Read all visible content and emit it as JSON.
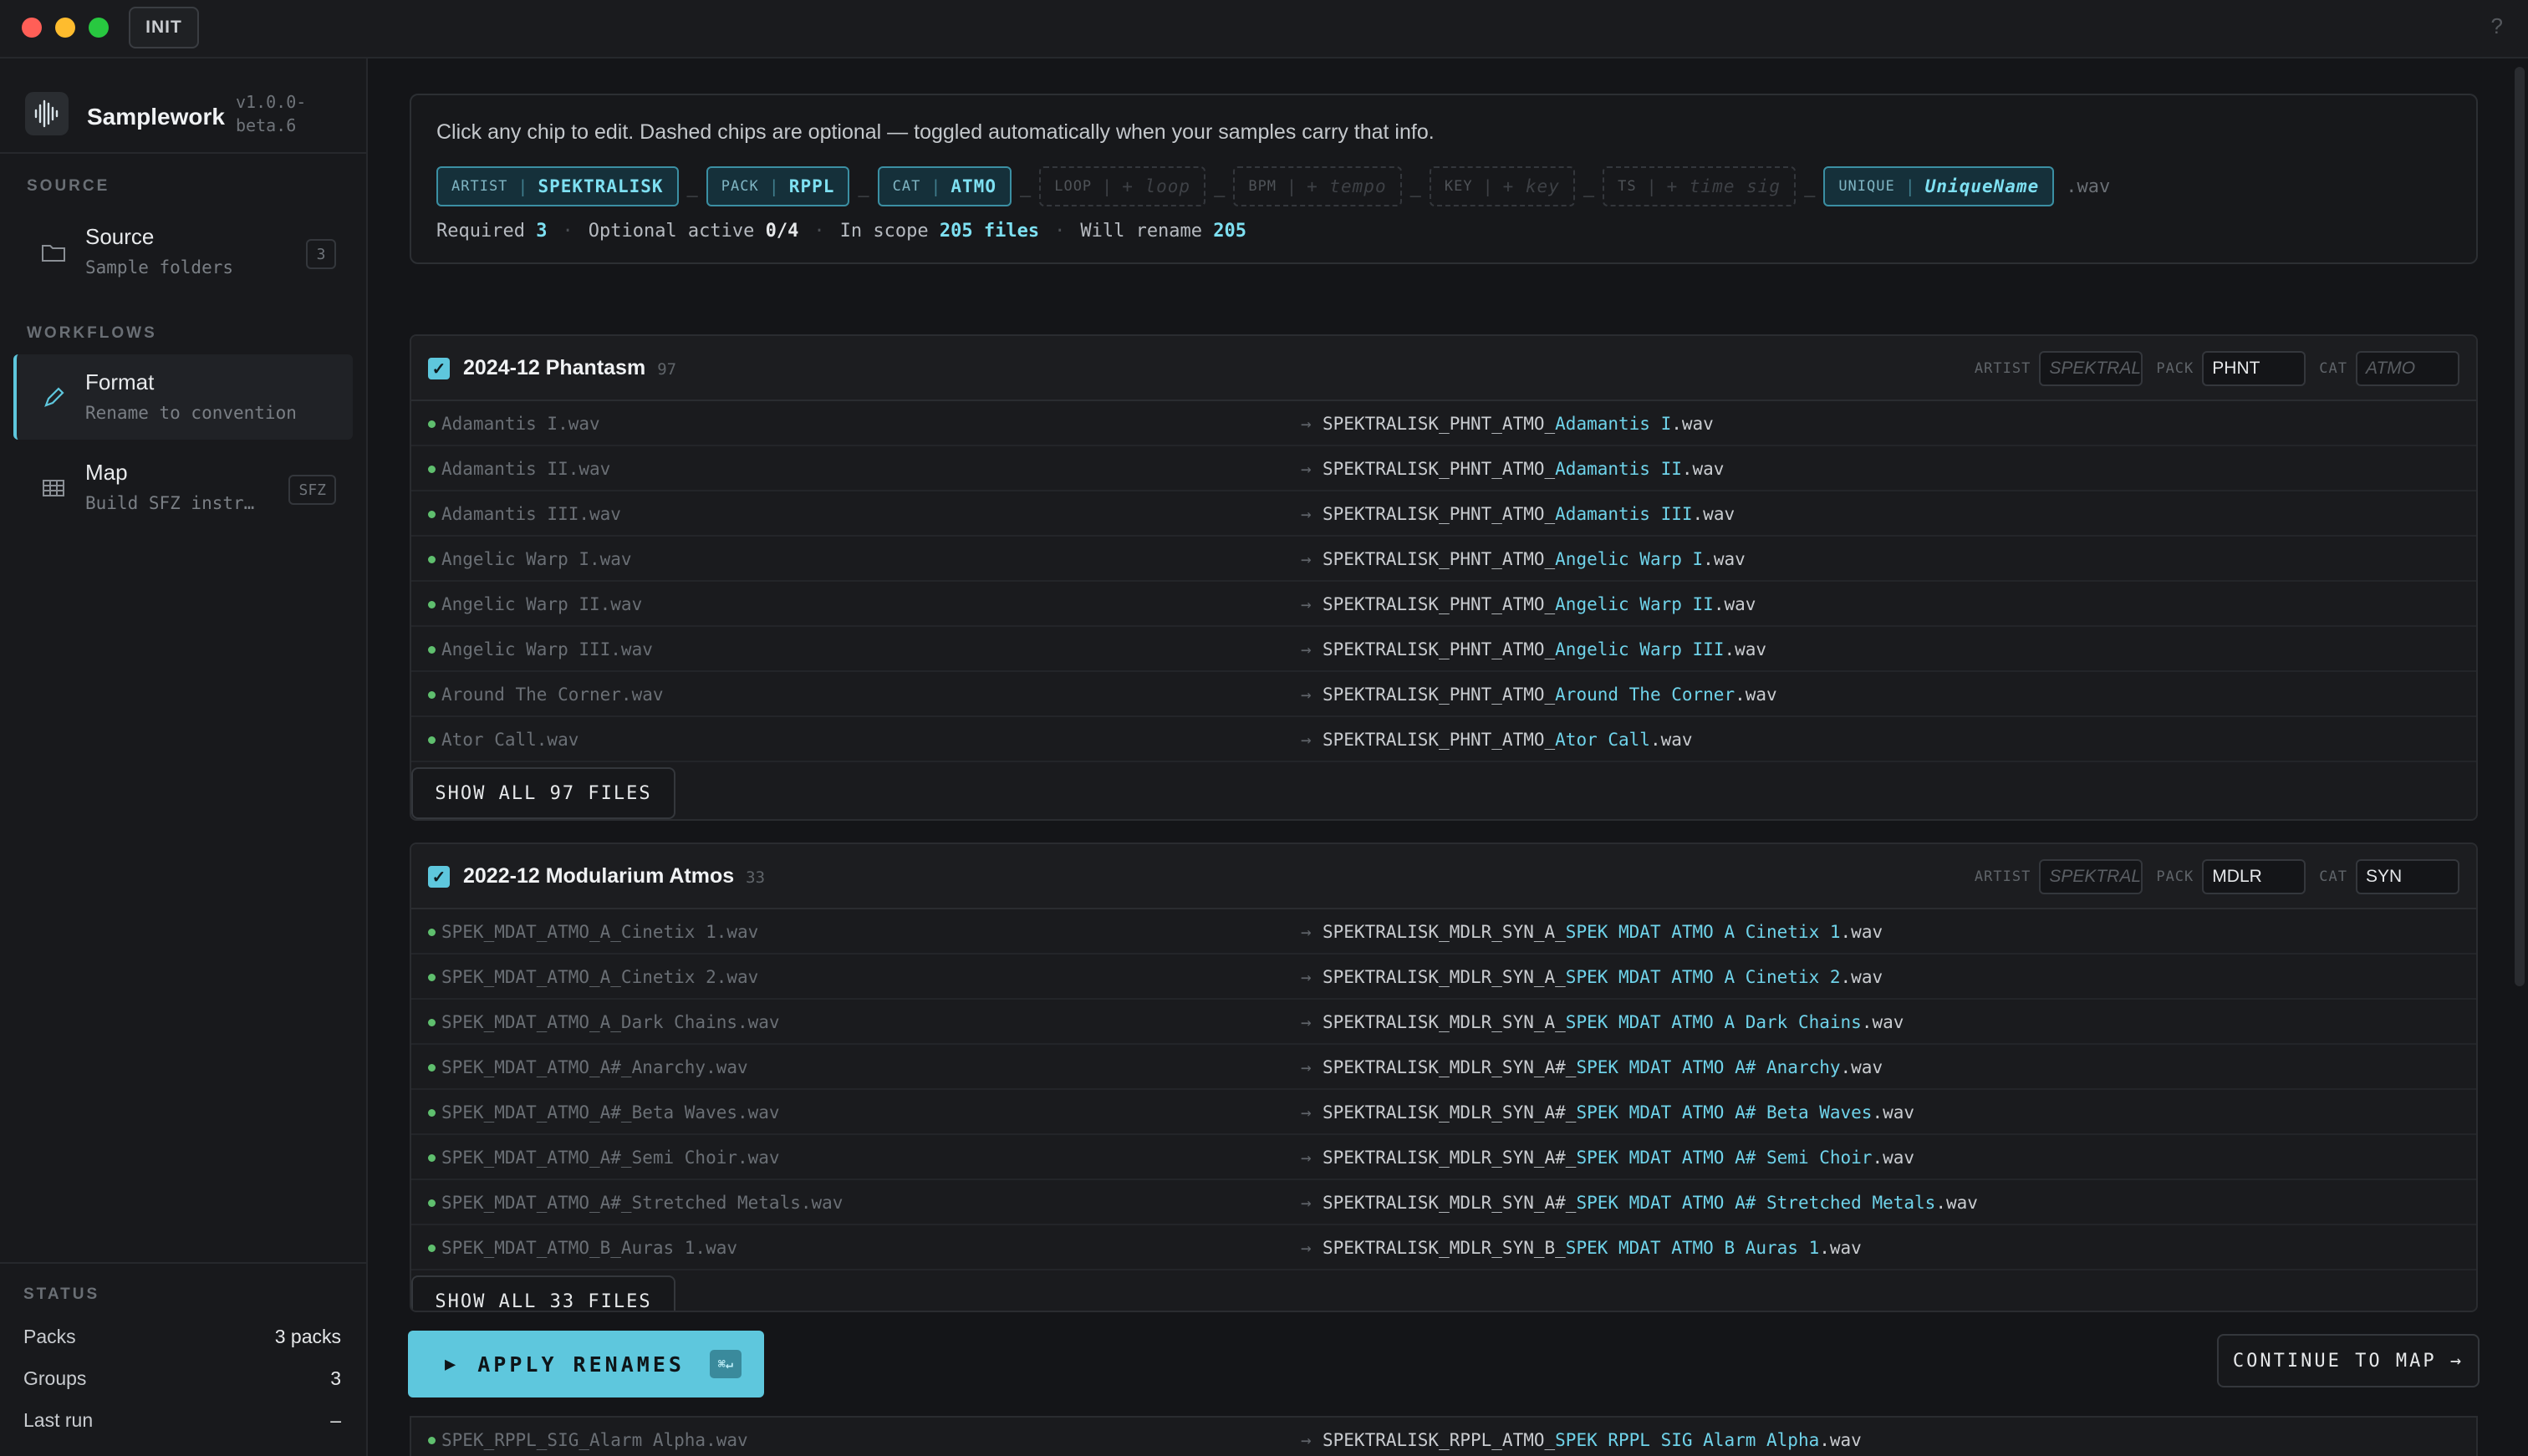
{
  "titlebar": {
    "init_label": "INIT",
    "help_label": "?"
  },
  "sidebar": {
    "app_name": "Samplework",
    "version": "v1.0.0-beta.6",
    "source_section": "SOURCE",
    "source_item": {
      "title": "Source",
      "subtitle": "Sample folders",
      "badge": "3"
    },
    "workflows_section": "WORKFLOWS",
    "workflows": [
      {
        "title": "Format",
        "subtitle": "Rename to convention",
        "badge": ""
      },
      {
        "title": "Map",
        "subtitle": "Build SFZ instr…",
        "badge": "SFZ"
      }
    ],
    "status_section": "STATUS",
    "status": [
      {
        "label": "Packs",
        "value": "3 packs"
      },
      {
        "label": "Groups",
        "value": "3"
      },
      {
        "label": "Last run",
        "value": "–"
      }
    ]
  },
  "pattern": {
    "hint": "Click any chip to edit. Dashed chips are optional — toggled automatically when your samples carry that info.",
    "chips": [
      {
        "key": "ARTIST",
        "value": "SPEKTRALISK"
      },
      {
        "key": "PACK",
        "value": "RPPL"
      },
      {
        "key": "CAT",
        "value": "ATMO"
      },
      {
        "key": "LOOP",
        "value": "+ loop"
      },
      {
        "key": "BPM",
        "value": "+ tempo"
      },
      {
        "key": "KEY",
        "value": "+ key"
      },
      {
        "key": "TS",
        "value": "+ time sig"
      },
      {
        "key": "UNIQUE",
        "value": "UniqueName"
      }
    ],
    "extension": ".wav",
    "stats": {
      "required_label": "Required",
      "required_value": "3",
      "optional_label": "Optional active",
      "optional_value": "0/4",
      "scope_label": "In scope",
      "scope_value": "205 files",
      "rename_label": "Will rename",
      "rename_value": "205"
    }
  },
  "groups": [
    {
      "title": "2024-12 Phantasm",
      "count": "97",
      "fields": {
        "artist_label": "ARTIST",
        "artist_value": "SPEKTRAL",
        "pack_label": "PACK",
        "pack_value": "PHNT",
        "cat_label": "CAT",
        "cat_value": "ATMO"
      },
      "rows": [
        {
          "orig": "Adamantis I.wav",
          "arrow": "→",
          "prefix": "SPEKTRALISK_PHNT_ATMO_",
          "unique": "Adamantis I",
          "ext": ".wav"
        },
        {
          "orig": "Adamantis II.wav",
          "arrow": "→",
          "prefix": "SPEKTRALISK_PHNT_ATMO_",
          "unique": "Adamantis II",
          "ext": ".wav"
        },
        {
          "orig": "Adamantis III.wav",
          "arrow": "→",
          "prefix": "SPEKTRALISK_PHNT_ATMO_",
          "unique": "Adamantis III",
          "ext": ".wav"
        },
        {
          "orig": "Angelic Warp I.wav",
          "arrow": "→",
          "prefix": "SPEKTRALISK_PHNT_ATMO_",
          "unique": "Angelic Warp I",
          "ext": ".wav"
        },
        {
          "orig": "Angelic Warp II.wav",
          "arrow": "→",
          "prefix": "SPEKTRALISK_PHNT_ATMO_",
          "unique": "Angelic Warp II",
          "ext": ".wav"
        },
        {
          "orig": "Angelic Warp III.wav",
          "arrow": "→",
          "prefix": "SPEKTRALISK_PHNT_ATMO_",
          "unique": "Angelic Warp III",
          "ext": ".wav"
        },
        {
          "orig": "Around The Corner.wav",
          "arrow": "→",
          "prefix": "SPEKTRALISK_PHNT_ATMO_",
          "unique": "Around The Corner",
          "ext": ".wav"
        },
        {
          "orig": "Ator Call.wav",
          "arrow": "→",
          "prefix": "SPEKTRALISK_PHNT_ATMO_",
          "unique": "Ator Call",
          "ext": ".wav"
        }
      ],
      "show_all": "SHOW ALL 97 FILES"
    },
    {
      "title": "2022-12 Modularium Atmos",
      "count": "33",
      "fields": {
        "artist_label": "ARTIST",
        "artist_value": "SPEKTRAL",
        "pack_label": "PACK",
        "pack_value": "MDLR",
        "cat_label": "CAT",
        "cat_value": "SYN"
      },
      "rows": [
        {
          "orig": "SPEK_MDAT_ATMO_A_Cinetix 1.wav",
          "arrow": "→",
          "prefix": "SPEKTRALISK_MDLR_SYN_A_",
          "unique": "SPEK MDAT ATMO A Cinetix 1",
          "ext": ".wav"
        },
        {
          "orig": "SPEK_MDAT_ATMO_A_Cinetix 2.wav",
          "arrow": "→",
          "prefix": "SPEKTRALISK_MDLR_SYN_A_",
          "unique": "SPEK MDAT ATMO A Cinetix 2",
          "ext": ".wav"
        },
        {
          "orig": "SPEK_MDAT_ATMO_A_Dark Chains.wav",
          "arrow": "→",
          "prefix": "SPEKTRALISK_MDLR_SYN_A_",
          "unique": "SPEK MDAT ATMO A Dark Chains",
          "ext": ".wav"
        },
        {
          "orig": "SPEK_MDAT_ATMO_A#_Anarchy.wav",
          "arrow": "→",
          "prefix": "SPEKTRALISK_MDLR_SYN_A#_",
          "unique": "SPEK MDAT ATMO A# Anarchy",
          "ext": ".wav"
        },
        {
          "orig": "SPEK_MDAT_ATMO_A#_Beta Waves.wav",
          "arrow": "→",
          "prefix": "SPEKTRALISK_MDLR_SYN_A#_",
          "unique": "SPEK MDAT ATMO A# Beta Waves",
          "ext": ".wav"
        },
        {
          "orig": "SPEK_MDAT_ATMO_A#_Semi Choir.wav",
          "arrow": "→",
          "prefix": "SPEKTRALISK_MDLR_SYN_A#_",
          "unique": "SPEK MDAT ATMO A# Semi Choir",
          "ext": ".wav"
        },
        {
          "orig": "SPEK_MDAT_ATMO_A#_Stretched Metals.wav",
          "arrow": "→",
          "prefix": "SPEKTRALISK_MDLR_SYN_A#_",
          "unique": "SPEK MDAT ATMO A# Stretched Metals",
          "ext": ".wav"
        },
        {
          "orig": "SPEK_MDAT_ATMO_B_Auras 1.wav",
          "arrow": "→",
          "prefix": "SPEKTRALISK_MDLR_SYN_B_",
          "unique": "SPEK MDAT ATMO B Auras 1",
          "ext": ".wav"
        }
      ],
      "show_all": "SHOW ALL 33 FILES"
    }
  ],
  "peek_row": {
    "orig": "SPEK_RPPL_SIG_Alarm Alpha.wav",
    "arrow": "→",
    "prefix": "SPEKTRALISK_RPPL_ATMO_",
    "unique": "SPEK RPPL SIG Alarm Alpha",
    "ext": ".wav"
  },
  "actions": {
    "apply_label": "APPLY RENAMES",
    "apply_play": "▶",
    "apply_shortcut": "⌘↵",
    "continue_label": "CONTINUE TO MAP →"
  },
  "colors": {
    "accent": "#5ec7dd",
    "status_ok": "#5fbf6e",
    "background": "#141518"
  }
}
